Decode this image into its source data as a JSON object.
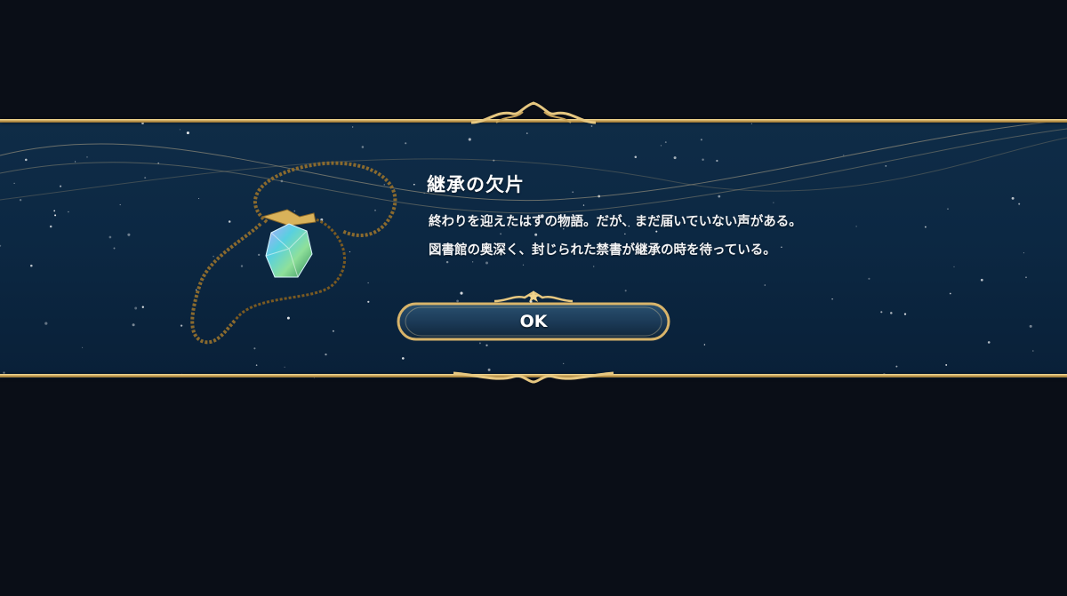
{
  "dialog": {
    "title": "継承の欠片",
    "lines": [
      "終わりを迎えたはずの物語。だが、まだ届いていない声がある。",
      "図書館の奥深く、封じられた禁書が継承の時を待っている。"
    ],
    "ok_label": "OK"
  },
  "item": {
    "icon": "crystal-necklace-icon"
  },
  "colors": {
    "background": "#0a0e17",
    "banner": "#0c2843",
    "gold": "#d8b46a",
    "text": "#ffffff"
  }
}
